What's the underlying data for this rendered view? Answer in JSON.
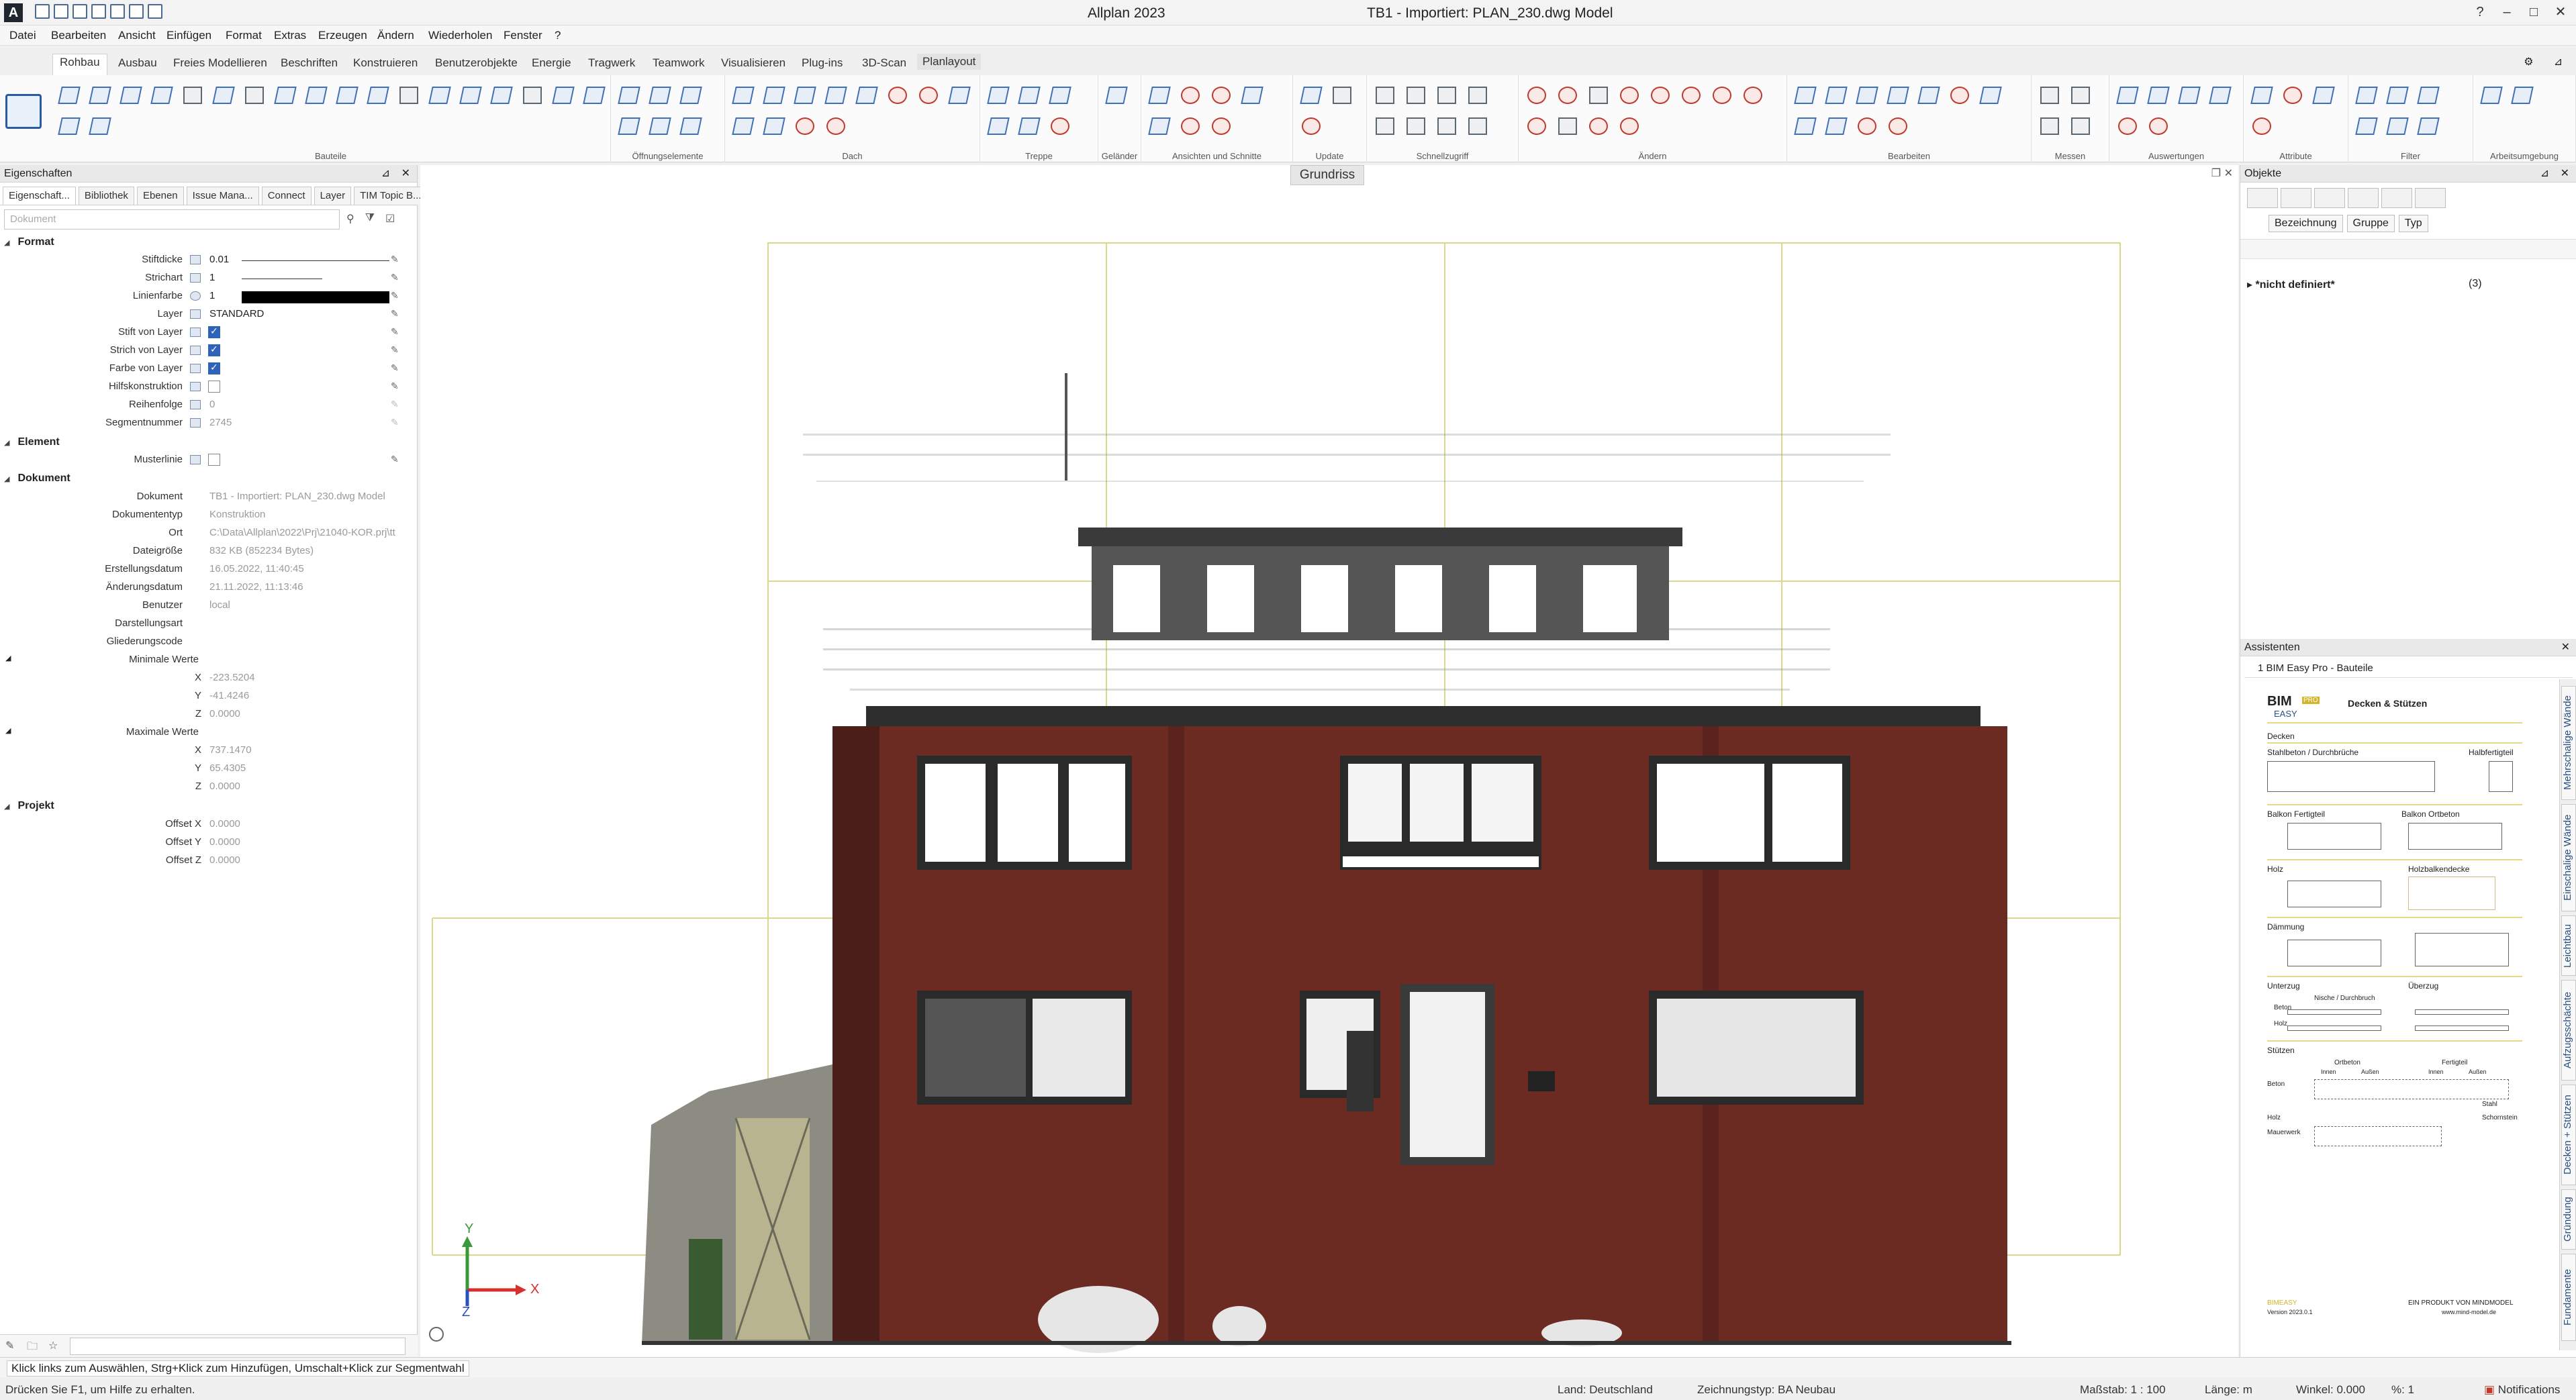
{
  "titlebar": {
    "app_logo": "A",
    "app_title": "Allplan 2023",
    "doc_title": "TB1 - Importiert: PLAN_230.dwg Model"
  },
  "menu": [
    "Datei",
    "Bearbeiten",
    "Ansicht",
    "Einfügen",
    "Format",
    "Extras",
    "Erzeugen",
    "Ändern",
    "Wiederholen",
    "Fenster",
    "?"
  ],
  "ribbon_tabs": [
    "Rohbau",
    "Ausbau",
    "Freies Modellieren",
    "Beschriften",
    "Konstruieren",
    "Benutzerobjekte",
    "Energie",
    "Tragwerk",
    "Teamwork",
    "Visualisieren",
    "Plug-ins",
    "3D-Scan",
    "Planlayout"
  ],
  "ribbon_groups": [
    "Bauteile",
    "Öffnungselemente",
    "Dach",
    "Treppe",
    "Geländer",
    "Ansichten und Schnitte",
    "Update",
    "Schnellzugriff",
    "Ändern",
    "Bearbeiten",
    "Messen",
    "Auswertungen",
    "Attribute",
    "Filter",
    "Arbeitsumgebung"
  ],
  "properties": {
    "panel_title": "Eigenschaften",
    "tabs": [
      "Eigenschaft...",
      "Bibliothek",
      "Ebenen",
      "Issue Mana...",
      "Connect",
      "Layer",
      "TIM Topic B..."
    ],
    "doc_selector": "Dokument",
    "sections": {
      "format": "Format",
      "element": "Element",
      "dokument": "Dokument",
      "projekt": "Projekt"
    },
    "format": {
      "stiftdicke_label": "Stiftdicke",
      "stiftdicke": "0.01",
      "strichart_label": "Strichart",
      "strichart": "1",
      "linienfarbe_label": "Linienfarbe",
      "linienfarbe": "1",
      "layer_label": "Layer",
      "layer": "STANDARD",
      "stift_von_layer_label": "Stift von Layer",
      "strich_von_layer_label": "Strich von Layer",
      "farbe_von_layer_label": "Farbe von Layer",
      "hilfskonstruktion_label": "Hilfskonstruktion",
      "reihenfolge_label": "Reihenfolge",
      "reihenfolge": "0",
      "segmentnummer_label": "Segmentnummer",
      "segmentnummer": "2745"
    },
    "element": {
      "musterlinie_label": "Musterlinie"
    },
    "dokument": {
      "dokument_label": "Dokument",
      "dokument": "TB1 - Importiert: PLAN_230.dwg Model",
      "dokumententyp_label": "Dokumententyp",
      "dokumententyp": "Konstruktion",
      "ort_label": "Ort",
      "ort": "C:\\Data\\Allplan\\2022\\Prj\\21040-KOR.prj\\tt",
      "dateigroesse_label": "Dateigröße",
      "dateigroesse": "832 KB (852234 Bytes)",
      "erstellungsdatum_label": "Erstellungsdatum",
      "erstellungsdatum": "16.05.2022, 11:40:45",
      "aenderungsdatum_label": "Änderungsdatum",
      "aenderungsdatum": "21.11.2022, 11:13:46",
      "benutzer_label": "Benutzer",
      "benutzer": "local",
      "darstellungsart_label": "Darstellungsart",
      "gliederungscode_label": "Gliederungscode",
      "min_label": "Minimale Werte",
      "min_x": "-223.5204",
      "min_y": "-41.4246",
      "min_z": "0.0000",
      "max_label": "Maximale Werte",
      "max_x": "737.1470",
      "max_y": "65.4305",
      "max_z": "0.0000",
      "x": "X",
      "y": "Y",
      "z": "Z"
    },
    "projekt": {
      "offset_x_label": "Offset X",
      "offset_x": "0.0000",
      "offset_y_label": "Offset Y",
      "offset_y": "0.0000",
      "offset_z_label": "Offset Z",
      "offset_z": "0.0000"
    }
  },
  "view": {
    "title": "Grundriss",
    "axis_x": "X",
    "axis_y": "Y",
    "axis_z": "Z"
  },
  "objekte": {
    "title": "Objekte",
    "filters": [
      "Bezeichnung",
      "Gruppe",
      "Typ"
    ],
    "row_label": "*nicht definiert*",
    "row_count": "(3)"
  },
  "assistent": {
    "title": "Assistenten",
    "selected": "1 BIM Easy Pro - Bauteile",
    "logo_top": "BIM",
    "logo_pro": "PRO",
    "logo_bottom": "EASY",
    "heading": "Decken & Stützen",
    "labels": [
      "Decken",
      "Stahlbeton / Durchbrüche",
      "Halbfertigteil",
      "Balkon Fertigteil",
      "Balkon Ortbeton",
      "Holz",
      "Holzbalkendecke",
      "Dämmung",
      "Unterzug",
      "Überzug",
      "Nische / Durchbruch",
      "Beton",
      "Holz",
      "Stützen",
      "Ortbeton",
      "Fertigteil",
      "Innen",
      "Außen",
      "Innen",
      "Außen",
      "Beton",
      "Holz",
      "Mauerwerk",
      "Stahl",
      "Schornstein"
    ],
    "footer_left": "BIMEASY",
    "footer_right": "EIN PRODUKT VON MINDMODEL",
    "version": "Version 2023.0.1",
    "url": "www.mind-model.de",
    "side_tabs": [
      "Mehrschalige Wände",
      "Einschalige Wände",
      "Leichtbau",
      "Aufzugsschächte",
      "Decken + Stützen",
      "Gründung",
      "Fundamente"
    ]
  },
  "hint": "Klick links zum Auswählen, Strg+Klick zum Hinzufügen, Umschalt+Klick zur Segmentwahl",
  "status": {
    "help": "Drücken Sie F1, um Hilfe zu erhalten.",
    "land": "Land: Deutschland",
    "zeichnungstyp": "Zeichnungstyp: BA Neubau",
    "massstab": "Maßstab: 1 : 100",
    "laenge": "Länge: m",
    "winkel": "Winkel: 0.000",
    "prozent": "%: 1",
    "notifications": "Notifications"
  },
  "colors": {
    "accent": "#2e63b8",
    "grid": "#d9d98a",
    "brick": "#6b2a22",
    "axis_x": "#d6302c",
    "axis_y": "#3a9a3a",
    "axis_z": "#2a4fbf"
  }
}
